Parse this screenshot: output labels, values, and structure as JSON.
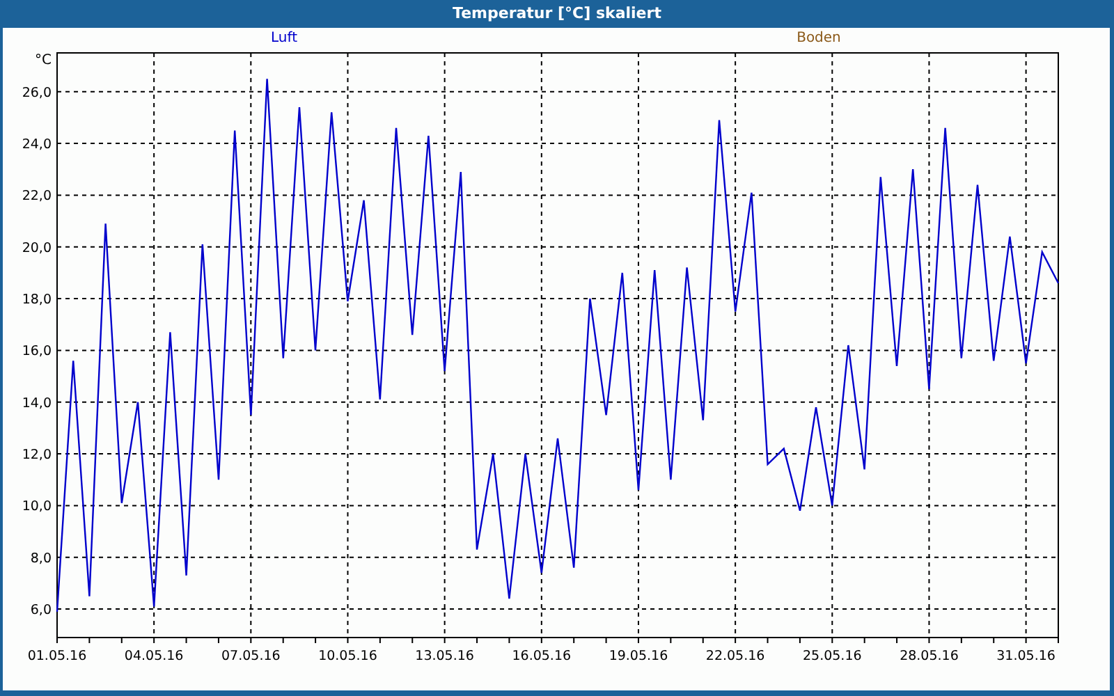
{
  "window": {
    "title": "Temperatur [°C] skaliert"
  },
  "legend": [
    {
      "label": "Boden",
      "color": "#8b5a1a"
    }
  ],
  "chart_data": {
    "type": "line",
    "grid": true,
    "ylabel": "°C",
    "ylim": [
      4.9,
      27.5
    ],
    "categories": [
      "01.05.16",
      null,
      null,
      null,
      null,
      null,
      "04.05.16",
      null,
      null,
      null,
      null,
      null,
      "07.05.16",
      null,
      null,
      null,
      null,
      null,
      "10.05.16",
      null,
      null,
      null,
      null,
      null,
      "13.05.16",
      null,
      null,
      null,
      null,
      null,
      "16.05.16",
      null,
      null,
      null,
      null,
      null,
      "19.05.16",
      null,
      null,
      null,
      null,
      null,
      "22.05.16",
      null,
      null,
      null,
      null,
      null,
      "25.05.16",
      null,
      null,
      null,
      null,
      null,
      "28.05.16",
      null,
      null,
      null,
      null,
      null,
      "31.05.16",
      null,
      null
    ],
    "yticks": [
      {
        "value": 6,
        "label": "6,0"
      },
      {
        "value": 8,
        "label": "8,0"
      },
      {
        "value": 10,
        "label": "10,0"
      },
      {
        "value": 12,
        "label": "12,0"
      },
      {
        "value": 14,
        "label": "14,0"
      },
      {
        "value": 16,
        "label": "16,0"
      },
      {
        "value": 18,
        "label": "18,0"
      },
      {
        "value": 20,
        "label": "20,0"
      },
      {
        "value": 22,
        "label": "22,0"
      },
      {
        "value": 24,
        "label": "24,0"
      },
      {
        "value": 26,
        "label": "26,0"
      }
    ],
    "series": [
      {
        "name": "Luft",
        "color": "#0000cc",
        "values": [
          5.9,
          15.6,
          6.5,
          20.9,
          10.1,
          14.0,
          6.1,
          16.7,
          7.3,
          20.1,
          11.0,
          24.5,
          13.5,
          26.5,
          15.7,
          25.4,
          16.0,
          25.2,
          17.9,
          21.8,
          14.1,
          24.6,
          16.6,
          24.3,
          15.2,
          22.9,
          8.3,
          12.0,
          6.4,
          12.0,
          7.4,
          12.6,
          7.6,
          18.0,
          13.5,
          19.0,
          10.6,
          19.1,
          11.0,
          19.2,
          13.3,
          24.9,
          17.5,
          22.1,
          11.6,
          12.2,
          9.8,
          13.8,
          10.0,
          16.2,
          11.4,
          22.7,
          15.4,
          23.0,
          14.5,
          24.6,
          15.7,
          22.4,
          15.6,
          20.4,
          15.5,
          19.8,
          18.6
        ]
      }
    ]
  }
}
